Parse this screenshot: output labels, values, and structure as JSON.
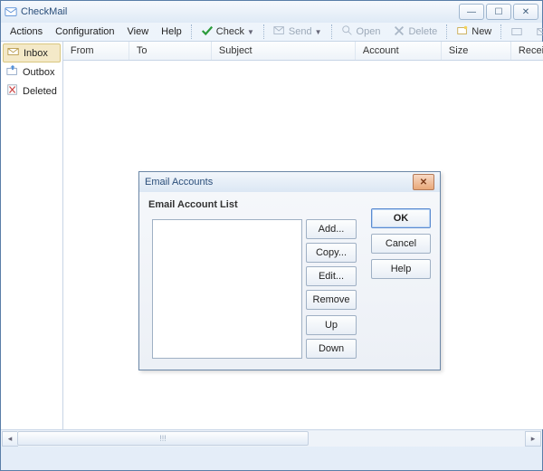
{
  "app": {
    "title": "CheckMail"
  },
  "menu": {
    "actions": "Actions",
    "configuration": "Configuration",
    "view": "View",
    "help": "Help"
  },
  "toolbar": {
    "check": "Check",
    "send": "Send",
    "open": "Open",
    "delete": "Delete",
    "new": "New"
  },
  "sidebar": {
    "items": [
      {
        "label": "Inbox"
      },
      {
        "label": "Outbox"
      },
      {
        "label": "Deleted"
      }
    ]
  },
  "columns": {
    "from": "From",
    "to": "To",
    "subject": "Subject",
    "account": "Account",
    "size": "Size",
    "received": "Received"
  },
  "scroll_thumb": "!!!",
  "dialog": {
    "title": "Email Accounts",
    "list_label": "Email Account List",
    "add": "Add...",
    "copy": "Copy...",
    "edit": "Edit...",
    "remove": "Remove",
    "up": "Up",
    "down": "Down",
    "ok": "OK",
    "cancel": "Cancel",
    "help": "Help"
  }
}
